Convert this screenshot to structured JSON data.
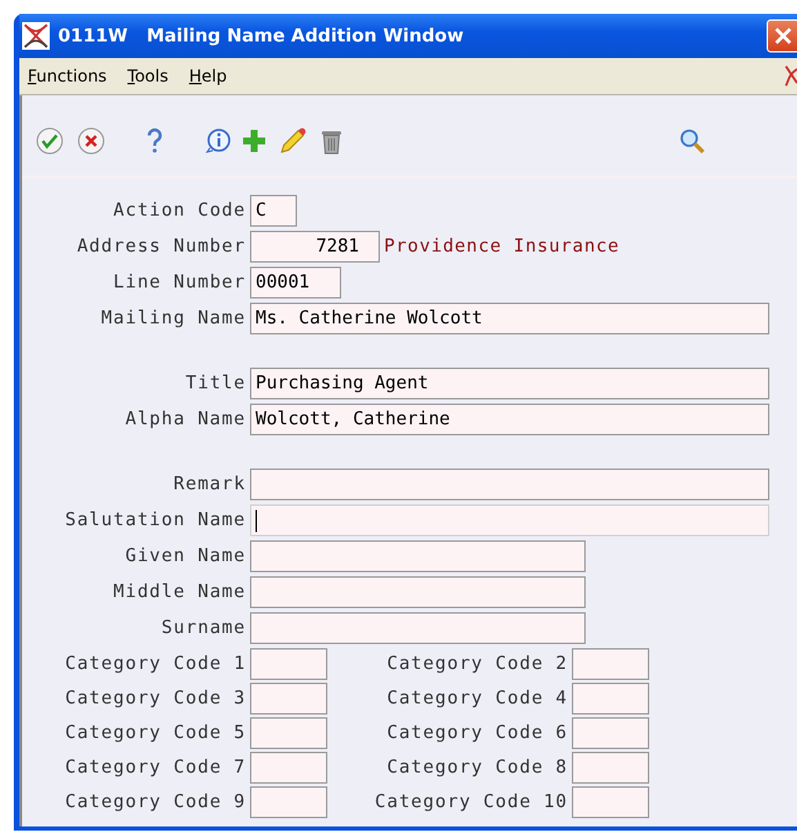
{
  "window": {
    "code": "0111W",
    "title": "Mailing Name Addition Window"
  },
  "menu": [
    "Functions",
    "Tools",
    "Help"
  ],
  "toolbar": [
    {
      "kind": "ok"
    },
    {
      "kind": "cancel"
    },
    {
      "kind": "help"
    },
    {
      "kind": "info"
    },
    {
      "kind": "add"
    },
    {
      "kind": "edit"
    },
    {
      "kind": "delete"
    },
    {
      "kind": "search"
    }
  ],
  "groups": [
    [
      {
        "label": "Action Code",
        "value": "C",
        "kind": "xs",
        "focused": false
      },
      {
        "label": "Address Number",
        "value": "7281",
        "kind": "num",
        "focused": false,
        "description": "Providence Insurance"
      },
      {
        "label": "Line Number",
        "value": "00001",
        "kind": "s",
        "focused": false
      },
      {
        "label": "Mailing Name",
        "value": "Ms. Catherine Wolcott",
        "kind": "l",
        "focused": false
      }
    ],
    [
      {
        "label": "Title",
        "value": "Purchasing Agent",
        "kind": "l",
        "focused": false
      },
      {
        "label": "Alpha Name",
        "value": "Wolcott, Catherine",
        "kind": "l",
        "focused": false
      }
    ],
    [
      {
        "label": "Remark",
        "kind": "l",
        "focused": false
      },
      {
        "label": "Salutation Name",
        "kind": "l",
        "focused": true
      },
      {
        "label": "Given Name",
        "kind": "m",
        "focused": false
      },
      {
        "label": "Middle Name",
        "kind": "m",
        "focused": false
      },
      {
        "label": "Surname",
        "kind": "m",
        "focused": false
      }
    ]
  ],
  "category_codes": [
    {
      "label": "Category Code 1"
    },
    {
      "label": "Category Code 2"
    },
    {
      "label": "Category Code 3"
    },
    {
      "label": "Category Code 4"
    },
    {
      "label": "Category Code 5"
    },
    {
      "label": "Category Code 6"
    },
    {
      "label": "Category Code 7"
    },
    {
      "label": "Category Code 8"
    },
    {
      "label": "Category Code 9"
    },
    {
      "label": "Category Code 10"
    }
  ]
}
